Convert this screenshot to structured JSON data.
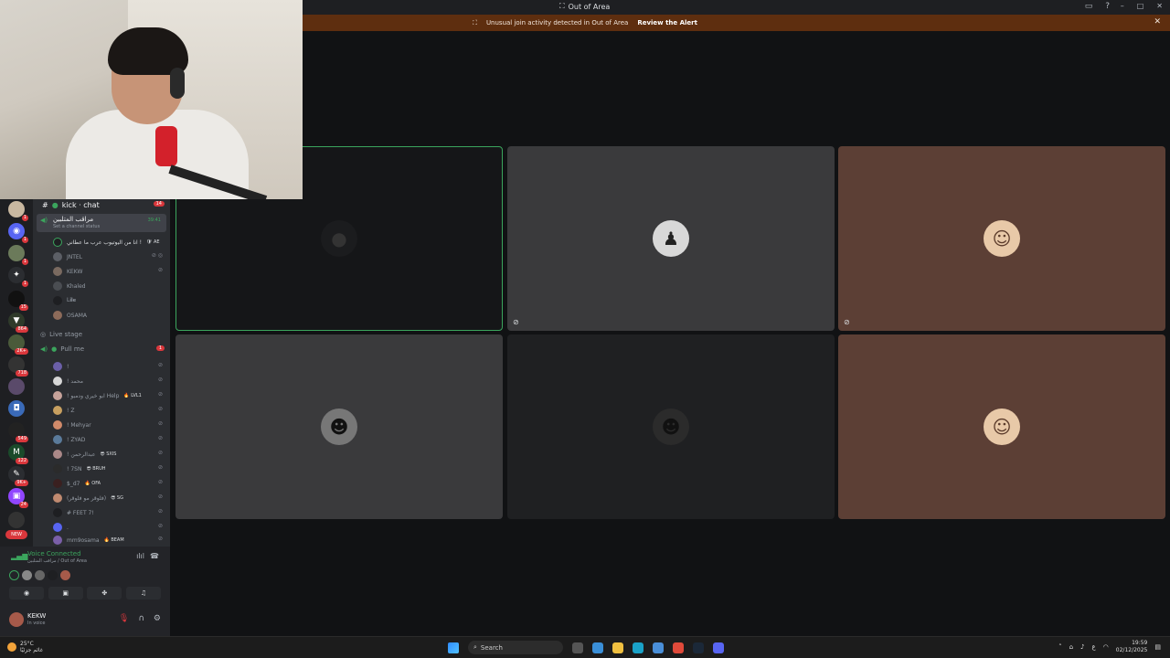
{
  "window": {
    "title": "Out of Area",
    "controls": [
      "–",
      "□",
      "✕"
    ],
    "toolbar_icons": [
      "inbox-icon",
      "help-icon"
    ]
  },
  "alert": {
    "text": "Unusual join activity detected in Out of Area",
    "button": "Review the Alert",
    "close": "✕"
  },
  "channel_sidebar": {
    "header": "kick · chat",
    "header_badge": "14",
    "selected_channel": {
      "name": "مراقب المتلبين",
      "status": "Set a channel status",
      "timer": "39:41"
    },
    "voice_members": [
      {
        "name": "انا من اليوتيوب عرب ما عطاني !",
        "tag": "🛡 AE",
        "avatar_color": "#1e1f22"
      },
      {
        "name": "JNTEL",
        "tag": "",
        "avatar_color": "#5c5f66"
      },
      {
        "name": "KEKW",
        "tag": "",
        "avatar_color": "#7a6a60"
      },
      {
        "name": "Khaled",
        "tag": "",
        "avatar_color": "#4a4d52"
      },
      {
        "name": "L𝐢𝐥𝐞",
        "tag": "",
        "avatar_color": "#1e1f22"
      },
      {
        "name": "OSAMA",
        "tag": "",
        "avatar_color": "#8d6b5a"
      }
    ],
    "live_stage_label": "Live stage",
    "pull_me": {
      "label": "Pull me",
      "badge": "1"
    },
    "stage_members": [
      {
        "name": "!",
        "tag": "",
        "avatar_color": "#6b5fa8"
      },
      {
        "name": "! محمد",
        "tag": "",
        "avatar_color": "#d7d7d7"
      },
      {
        "name": "! ابو خيري ودمبو Help",
        "tag": "🔥 LVL1",
        "avatar_color": "#c6a29a"
      },
      {
        "name": "! Z",
        "tag": "",
        "avatar_color": "#c8a060"
      },
      {
        "name": "! Mehyar",
        "tag": "",
        "avatar_color": "#d08a6a"
      },
      {
        "name": "! ZYAD",
        "tag": "",
        "avatar_color": "#5a7a9a"
      },
      {
        "name": "! عبدالرحمن",
        "tag": "😎 SXIS",
        "avatar_color": "#a88"
      },
      {
        "name": "! 7SN",
        "tag": "😎 BRUH",
        "avatar_color": "#2b2b2b"
      },
      {
        "name": "$_d7",
        "tag": "🔥 OFA",
        "avatar_color": "#2b2b2b"
      },
      {
        "name": "(فلوقر مو فلوقر)",
        "tag": "😎 SG",
        "avatar_color": "#c08a70"
      },
      {
        "name": "# FEET 7!",
        "tag": "",
        "avatar_color": "#1e1f22"
      },
      {
        "name": ".",
        "tag": "",
        "avatar_color": "#5865f2"
      },
      {
        "name": "mm9osama",
        "tag": "🔥 BEAM",
        "avatar_color": "#7a5fa8"
      }
    ]
  },
  "server_badges": [
    "1",
    "1",
    "1",
    "1",
    "15",
    "864",
    "2K+",
    "718",
    "549",
    "122",
    "9K+",
    "24",
    "NEW"
  ],
  "voice_panel": {
    "status": "Voice Connected",
    "location": "مراقب المتلبين / Out of Area",
    "action_icons": [
      "camera-icon",
      "screen-share-icon",
      "activity-icon",
      "soundboard-icon"
    ]
  },
  "user_panel": {
    "name": "KEKW",
    "status": "In voice"
  },
  "video_tiles": [
    {
      "bg": "#151618",
      "speaking": true,
      "muted": false,
      "avatar": "dark-avatar"
    },
    {
      "bg": "#3a3a3c",
      "speaking": false,
      "muted": true,
      "avatar": "suit-avatar"
    },
    {
      "bg": "#5c3f35",
      "speaking": false,
      "muted": true,
      "avatar": "cartoon-avatar"
    },
    {
      "bg": "#3a3a3c",
      "speaking": false,
      "muted": false,
      "avatar": "bw-avatar"
    },
    {
      "bg": "#1f2022",
      "speaking": false,
      "muted": false,
      "avatar": "shadow-avatar"
    },
    {
      "bg": "#5c3f35",
      "speaking": false,
      "muted": false,
      "avatar": "cartoon-avatar"
    }
  ],
  "taskbar": {
    "weather_temp": "25°C",
    "weather_desc": "غائم جزئيًا",
    "search_placeholder": "Search",
    "time": "19:59",
    "date": "02/12/2025",
    "lang": "ع"
  }
}
